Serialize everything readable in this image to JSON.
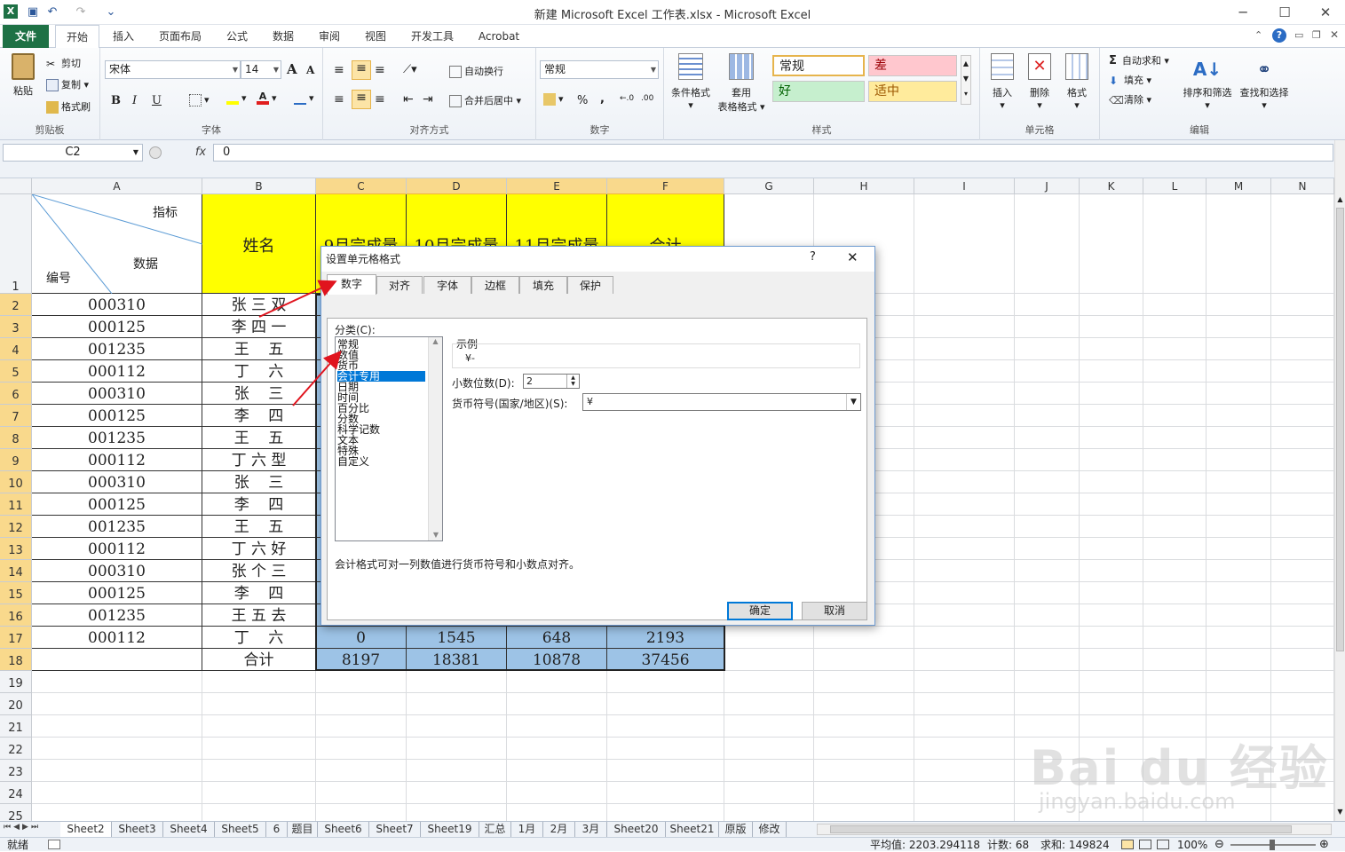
{
  "window": {
    "title": "新建 Microsoft Excel 工作表.xlsx  -  Microsoft Excel",
    "minimize": "─",
    "maximize": "☐",
    "close": "✕"
  },
  "ribbon_tabs": [
    "文件",
    "开始",
    "插入",
    "页面布局",
    "公式",
    "数据",
    "审阅",
    "视图",
    "开发工具",
    "Acrobat"
  ],
  "ribbon": {
    "clipboard": {
      "paste": "粘贴",
      "cut": "剪切",
      "copy": "复制",
      "format_painter": "格式刷",
      "label": "剪贴板"
    },
    "font": {
      "name": "宋体",
      "size": "14",
      "label": "字体",
      "bold": "B",
      "italic": "I",
      "underline": "U",
      "grow": "A",
      "shrink": "A"
    },
    "alignment": {
      "wrap": "自动换行",
      "merge": "合并后居中",
      "label": "对齐方式"
    },
    "number": {
      "format": "常规",
      "percent": "%",
      "comma": ",",
      "label": "数字"
    },
    "styles": {
      "conditional": "条件格式",
      "table_format_1": "套用",
      "table_format_2": "表格格式",
      "normal": "常规",
      "bad": "差",
      "good": "好",
      "neutral": "适中",
      "label": "样式"
    },
    "cells": {
      "insert": "插入",
      "delete": "删除",
      "format": "格式",
      "label": "单元格"
    },
    "editing": {
      "autosum": "自动求和",
      "fill": "填充",
      "clear": "清除",
      "sort": "排序和筛选",
      "find": "查找和选择",
      "label": "编辑"
    }
  },
  "formula_bar": {
    "name_box": "C2",
    "fx": "fx",
    "value": "0"
  },
  "columns": [
    "A",
    "B",
    "C",
    "D",
    "E",
    "F",
    "G",
    "H",
    "I",
    "J",
    "K",
    "L",
    "M",
    "N"
  ],
  "rows": [
    "1",
    "2",
    "3",
    "4",
    "5",
    "6",
    "7",
    "8",
    "9",
    "10",
    "11",
    "12",
    "13",
    "14",
    "15",
    "16",
    "17",
    "18",
    "19",
    "20",
    "21",
    "22",
    "23",
    "24",
    "25"
  ],
  "header_cells": {
    "a1_top": "指标",
    "a1_mid": "数据",
    "a1_bottom": "编号",
    "b1": "姓名",
    "c1": "9月完成量",
    "d1": "10月完成量",
    "e1": "11月完成量",
    "f1": "合计"
  },
  "table_rows": [
    {
      "id": "000310",
      "name": "张 三 双"
    },
    {
      "id": "000125",
      "name": "李 四 一"
    },
    {
      "id": "001235",
      "name": "王    五"
    },
    {
      "id": "000112",
      "name": "丁    六"
    },
    {
      "id": "000310",
      "name": "张    三"
    },
    {
      "id": "000125",
      "name": "李    四"
    },
    {
      "id": "001235",
      "name": "王    五"
    },
    {
      "id": "000112",
      "name": "丁 六 型"
    },
    {
      "id": "000310",
      "name": "张    三"
    },
    {
      "id": "000125",
      "name": "李    四"
    },
    {
      "id": "001235",
      "name": "王    五"
    },
    {
      "id": "000112",
      "name": "丁 六 好"
    },
    {
      "id": "000310",
      "name": "张 个 三"
    },
    {
      "id": "000125",
      "name": "李    四"
    },
    {
      "id": "001235",
      "name": "王 五 去"
    },
    {
      "id": "000112",
      "name": "丁    六"
    }
  ],
  "row17_values": [
    "0",
    "1545",
    "648",
    "2193"
  ],
  "total_row": {
    "label": "合计",
    "values": [
      "8197",
      "18381",
      "10878",
      "37456"
    ]
  },
  "sheet_tabs": [
    "Sheet2",
    "Sheet3",
    "Sheet4",
    "Sheet5",
    "6",
    "题目",
    "Sheet6",
    "Sheet7",
    "Sheet19",
    "汇总",
    "1月",
    "2月",
    "3月",
    "Sheet20",
    "Sheet21",
    "原版",
    "修改"
  ],
  "status": {
    "ready": "就绪",
    "average": "平均值: 2203.294118",
    "count": "计数: 68",
    "sum": "求和: 149824",
    "zoom": "100%"
  },
  "dialog": {
    "title": "设置单元格格式",
    "help": "?",
    "close": "✕",
    "tabs": [
      "数字",
      "对齐",
      "字体",
      "边框",
      "填充",
      "保护"
    ],
    "category_label": "分类(C):",
    "categories": [
      "常规",
      "数值",
      "货币",
      "会计专用",
      "日期",
      "时间",
      "百分比",
      "分数",
      "科学记数",
      "文本",
      "特殊",
      "自定义"
    ],
    "selected_category": "会计专用",
    "sample_label": "示例",
    "sample_value": "¥-",
    "decimal_label": "小数位数(D):",
    "decimal_value": "2",
    "currency_label": "货币符号(国家/地区)(S):",
    "currency_value": "¥",
    "description": "会计格式可对一列数值进行货币符号和小数点对齐。",
    "ok": "确定",
    "cancel": "取消"
  },
  "watermark": {
    "logo": "Bai du 经验",
    "url": "jingyan.baidu.com"
  },
  "colors": {
    "excel_green": "#1e7145",
    "header_yellow": "#ffff00",
    "selection_blue": "#9dc3e6",
    "arrow_red": "#e0141e"
  }
}
